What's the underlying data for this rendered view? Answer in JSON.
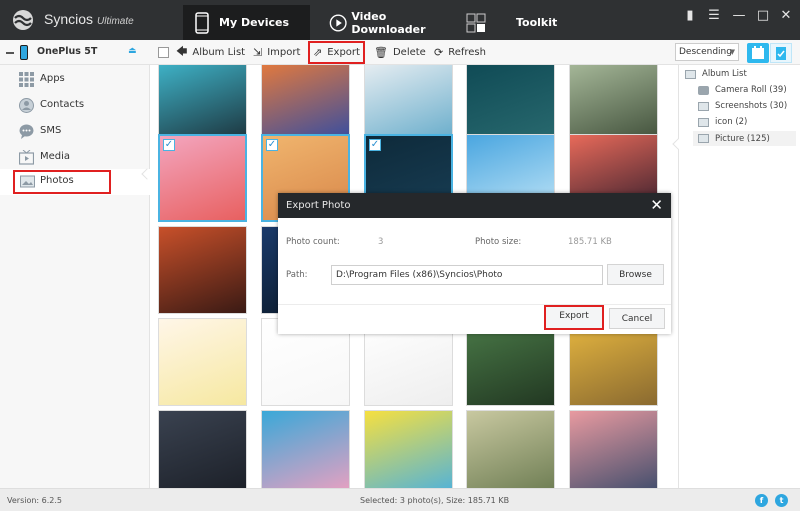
{
  "app": {
    "name": "Syncios",
    "edition": "Ultimate"
  },
  "nav_tabs": [
    {
      "label": "My Devices",
      "icon": "phone-icon",
      "active": true
    },
    {
      "label": "Video Downloader",
      "icon": "play-circle-icon",
      "active": false
    },
    {
      "label": "Toolkit",
      "icon": "grid-icon",
      "active": false
    }
  ],
  "window_controls": [
    "chat-icon",
    "menu-icon",
    "minimize-icon",
    "maximize-icon",
    "close-icon"
  ],
  "device": {
    "name": "OnePlus 5T"
  },
  "sidebar": {
    "items": [
      {
        "label": "Apps",
        "icon": "apps-grid-icon",
        "active": false
      },
      {
        "label": "Contacts",
        "icon": "contacts-icon",
        "active": false
      },
      {
        "label": "SMS",
        "icon": "sms-bubble-icon",
        "active": false
      },
      {
        "label": "Media",
        "icon": "media-tv-icon",
        "active": false
      },
      {
        "label": "Photos",
        "icon": "photos-icon",
        "active": true
      }
    ]
  },
  "toolbar": {
    "album_list": "Album List",
    "import": "Import",
    "export": "Export",
    "delete": "Delete",
    "refresh": "Refresh",
    "sort": "Descending",
    "view_modes": [
      "calendar-view-icon",
      "clipboard-view-icon"
    ]
  },
  "albums": {
    "root": "Album List",
    "items": [
      {
        "label": "Camera Roll (39)",
        "icon": "camera-icon"
      },
      {
        "label": "Screenshots (30)",
        "icon": "image-icon"
      },
      {
        "label": "icon (2)",
        "icon": "image-icon"
      },
      {
        "label": "Picture (125)",
        "icon": "image-icon",
        "active": true
      }
    ]
  },
  "photos": {
    "rows": [
      [
        {
          "desc": "blossom reflection",
          "colors": [
            "#3fb4c9",
            "#1a2b33"
          ],
          "selected": false
        },
        {
          "desc": "sunset bottle",
          "colors": [
            "#e57a3c",
            "#2a4aa8"
          ],
          "selected": false
        },
        {
          "desc": "kids on beach",
          "colors": [
            "#e8eef2",
            "#5fa8c8"
          ],
          "selected": false
        },
        {
          "desc": "white blossoms teal",
          "colors": [
            "#0f4a55",
            "#2a6b70"
          ],
          "selected": false
        },
        {
          "desc": "forest girls",
          "colors": [
            "#a7b99a",
            "#3b4a35"
          ],
          "selected": false
        }
      ],
      [
        {
          "desc": "cartoon girl pink",
          "colors": [
            "#f3a6bf",
            "#e86060"
          ],
          "selected": true
        },
        {
          "desc": "orange glow girl",
          "colors": [
            "#f0b56e",
            "#d8874a"
          ],
          "selected": true
        },
        {
          "desc": "blossom night",
          "colors": [
            "#0e2a3a",
            "#183e55"
          ],
          "selected": true
        },
        {
          "desc": "dandelion sky",
          "colors": [
            "#4aa6e0",
            "#c6e8f8"
          ],
          "selected": false
        },
        {
          "desc": "palm sunset",
          "colors": [
            "#e86a5a",
            "#2b1a2a"
          ],
          "selected": false
        }
      ],
      [
        {
          "desc": "lantern woman",
          "colors": [
            "#c8502a",
            "#3a1a14"
          ],
          "selected": false
        },
        {
          "desc": "starry night",
          "colors": [
            "#1a3a6a",
            "#0c1a2a"
          ],
          "selected": false
        },
        {
          "desc": "hidden",
          "colors": [
            "#cccccc",
            "#999999"
          ],
          "selected": false
        },
        {
          "desc": "hidden",
          "colors": [
            "#cccccc",
            "#999999"
          ],
          "selected": false
        },
        {
          "desc": "hidden",
          "colors": [
            "#cccccc",
            "#999999"
          ],
          "selected": false
        }
      ],
      [
        {
          "desc": "cartoon boy",
          "colors": [
            "#fff6e8",
            "#f6e8a0"
          ],
          "selected": false
        },
        {
          "desc": "pink hearts",
          "colors": [
            "#ffffff",
            "#f7f7f7"
          ],
          "selected": false
        },
        {
          "desc": "white robot",
          "colors": [
            "#ffffff",
            "#eeeeee"
          ],
          "selected": false
        },
        {
          "desc": "blossom green",
          "colors": [
            "#4a7a48",
            "#223822"
          ],
          "selected": false
        },
        {
          "desc": "autumn tree",
          "colors": [
            "#e8b840",
            "#8a6a30"
          ],
          "selected": false
        }
      ],
      [
        {
          "desc": "dark blossoms",
          "colors": [
            "#3a4250",
            "#1a1e26"
          ],
          "selected": false
        },
        {
          "desc": "sailor girl",
          "colors": [
            "#3aa8d8",
            "#f0a0c0"
          ],
          "selected": false
        },
        {
          "desc": "sponge cartoon",
          "colors": [
            "#f6e040",
            "#4ab0e0"
          ],
          "selected": false
        },
        {
          "desc": "girl by window",
          "colors": [
            "#c8c8a0",
            "#6a7a50"
          ],
          "selected": false
        },
        {
          "desc": "bottle sunset",
          "colors": [
            "#e89aa0",
            "#3a4a6a"
          ],
          "selected": false
        }
      ]
    ]
  },
  "dialog": {
    "title": "Export Photo",
    "count_label": "Photo count:",
    "count_value": "3",
    "size_label": "Photo size:",
    "size_value": "185.71 KB",
    "path_label": "Path:",
    "path_value": "D:\\Program Files (x86)\\Syncios\\Photo",
    "browse": "Browse",
    "export": "Export",
    "cancel": "Cancel"
  },
  "status": {
    "version": "Version: 6.2.5",
    "selection": "Selected: 3 photo(s), Size: 185.71 KB",
    "social": [
      "facebook-icon",
      "twitter-icon"
    ]
  },
  "colors": {
    "accent": "#2ea6df",
    "highlight": "#e02020",
    "titlebar": "#2f3133",
    "selected_border": "#4ab3e2"
  }
}
